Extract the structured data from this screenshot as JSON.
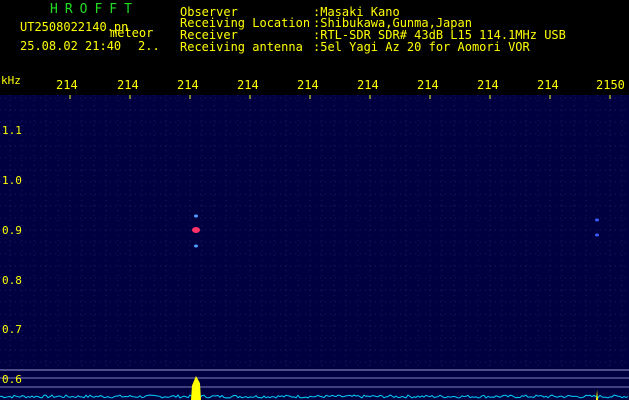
{
  "header": {
    "brand": "HROFFT",
    "filename": "UT2508022140.pn",
    "filename_suffix": "meteor",
    "timestamp": "25.08.02 21:40",
    "timestamp_count": "2..",
    "labels": {
      "observer": "Observer",
      "location": "Receiving Location",
      "receiver": "Receiver",
      "antenna": "Receiving antenna"
    },
    "values": {
      "observer": ":Masaki Kano",
      "location": ":Shibukawa,Gunma,Japan",
      "receiver": ":RTL-SDR SDR# 43dB L15 114.1MHz USB",
      "antenna": ":5el Yagi Az 20 for Aomori VOR"
    }
  },
  "chart_data": {
    "type": "heatmap",
    "title": "",
    "y_unit_label": "kHz",
    "x_tick_labels": [
      "214",
      "214",
      "214",
      "214",
      "214",
      "214",
      "214",
      "214",
      "214",
      "2150"
    ],
    "y_tick_labels": [
      "1.1",
      "1.0",
      "0.9",
      "0.8",
      "0.7",
      "0.6"
    ],
    "y_tick_values": [
      1.1,
      1.0,
      0.9,
      0.8,
      0.7,
      0.6
    ],
    "y_range_khz": [
      0.58,
      1.15
    ],
    "x_range_tick_index": [
      -0.3,
      9.6
    ],
    "background_color": "#000040",
    "grid_color": "#1a1a70",
    "echoes": [
      {
        "x_tick": 2.0,
        "y_khz": 0.9,
        "description": "meteor head echo",
        "color": "#ff3366"
      },
      {
        "x_tick": 2.0,
        "y_khz": 0.928,
        "color": "#4f9cff"
      },
      {
        "x_tick": 2.0,
        "y_khz": 0.868,
        "color": "#4f9cff"
      },
      {
        "x_tick": 8.7,
        "y_khz": 0.92,
        "color": "#3a5cff"
      },
      {
        "x_tick": 8.7,
        "y_khz": 0.89,
        "color": "#3a5cff"
      }
    ],
    "signal_strength_peaks": [
      {
        "x_tick": 2.0,
        "level": 1.0,
        "color": "#ffff00"
      },
      {
        "x_tick": 8.7,
        "level": 0.65,
        "color": "#ffff00"
      }
    ],
    "noise_trace_color": "#00d0ff"
  }
}
